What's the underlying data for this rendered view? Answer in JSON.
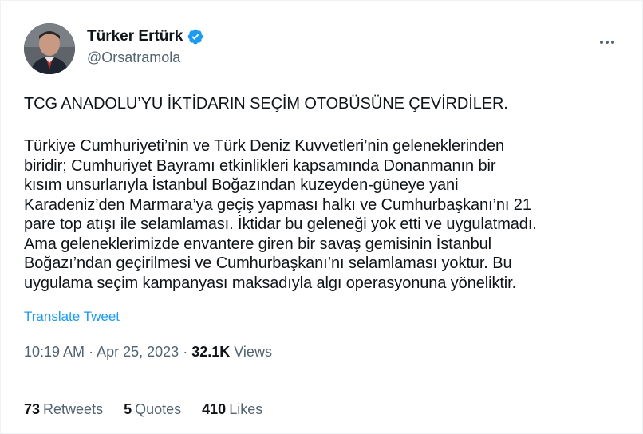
{
  "author": {
    "display_name": "Türker Ertürk",
    "handle": "@Orsatramola",
    "verified_icon": "verified-badge-icon",
    "accent_color": "#1d9bf0"
  },
  "more_icon": "more-horizontal-icon",
  "tweet": {
    "headline": "TCG ANADOLU’YU İKTİDARIN SEÇİM OTOBÜSÜNE ÇEVİRDİLER.",
    "body_lines": [
      "Türkiye Cumhuriyeti’nin ve Türk Deniz Kuvvetleri’nin geleneklerinden",
      "biridir; Cumhuriyet Bayramı etkinlikleri kapsamında Donanmanın bir",
      "kısım unsurlarıyla İstanbul Boğazından kuzeyden-güneye yani",
      "Karadeniz’den Marmara’ya geçiş yapması halkı ve Cumhurbaşkanı’nı 21",
      "pare top atışı ile selamlaması. İktidar bu geleneği yok etti ve uygulatmadı.",
      "Ama geleneklerimizde envantere giren bir savaş gemisinin İstanbul",
      "Boğazı’ndan geçirilmesi ve Cumhurbaşkanı’nı selamlaması yoktur. Bu",
      "uygulama seçim kampanyası maksadıyla algı operasyonuna yöneliktir."
    ],
    "translate_label": "Translate Tweet"
  },
  "meta": {
    "time": "10:19 AM",
    "separator": "·",
    "date": "Apr 25, 2023",
    "views_count": "32.1K",
    "views_label": "Views"
  },
  "stats": {
    "retweets_count": "73",
    "retweets_label": "Retweets",
    "quotes_count": "5",
    "quotes_label": "Quotes",
    "likes_count": "410",
    "likes_label": "Likes"
  }
}
